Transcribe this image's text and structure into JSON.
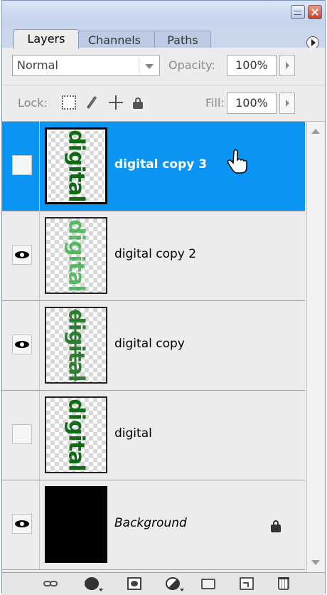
{
  "window": {
    "minimize_icon": "minimize-icon",
    "close_icon": "close-icon"
  },
  "tabs": [
    {
      "label": "Layers",
      "active": true
    },
    {
      "label": "Channels",
      "active": false
    },
    {
      "label": "Paths",
      "active": false
    }
  ],
  "blend": {
    "mode": "Normal",
    "opacity_label": "Opacity:",
    "opacity_value": "100%"
  },
  "lock": {
    "label": "Lock:",
    "fill_label": "Fill:",
    "fill_value": "100%"
  },
  "layers": [
    {
      "name": "digital copy 3",
      "visible": false,
      "selected": true,
      "thumb_text": "digital"
    },
    {
      "name": "digital copy 2",
      "visible": true,
      "selected": false,
      "thumb_text": "digital"
    },
    {
      "name": "digital copy",
      "visible": true,
      "selected": false,
      "thumb_text": "digital"
    },
    {
      "name": "digital",
      "visible": false,
      "selected": false,
      "thumb_text": "digital"
    },
    {
      "name": "Background",
      "visible": true,
      "selected": false,
      "locked": true
    }
  ],
  "bottom_bar": [
    "link-icon",
    "fx-icon",
    "mask-icon",
    "adjustment-icon",
    "folder-icon",
    "new-layer-icon",
    "trash-icon"
  ],
  "colors": {
    "selection": "#0a95f4",
    "panel": "#ececec",
    "text_green": "#0f6b14"
  }
}
